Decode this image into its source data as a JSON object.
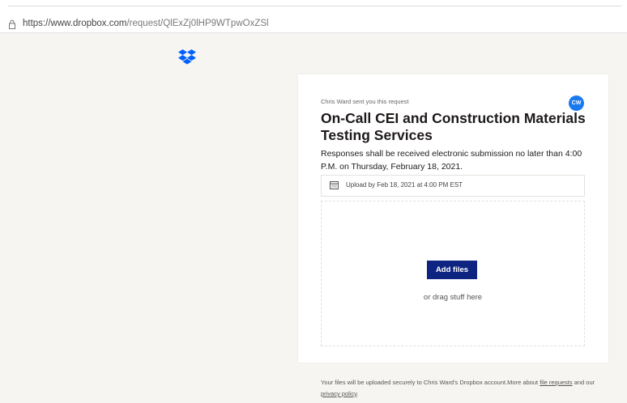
{
  "browser": {
    "url_prefix": "https://www.dropbox.com",
    "url_path": "/request/QlExZj0lHP9WTpwOxZSl",
    "lock_icon": "lock-icon"
  },
  "brand": {
    "logo_icon": "dropbox-logo-icon",
    "color": "#0061ff"
  },
  "request": {
    "sender_line": "Chris Ward sent you this request",
    "avatar_initials": "CW",
    "avatar_color": "#1a79ee",
    "title": "On-Call CEI and Construction Materials Testing Services",
    "description": "Responses shall be received electronic submission  no later than 4:00 P.M. on Thursday, February 18, 2021.",
    "deadline": "Upload by Feb 18, 2021 at 4:00 PM EST",
    "deadline_icon": "calendar-icon",
    "add_files_label": "Add files",
    "add_files_color": "#0d2481",
    "drag_text": "or drag stuff here"
  },
  "footer": {
    "text_before": "Your files will be uploaded securely to Chris Ward's Dropbox account.More about ",
    "file_requests_link": "file requests",
    "text_middle": " and our ",
    "privacy_link": "privacy policy",
    "text_after": "."
  }
}
